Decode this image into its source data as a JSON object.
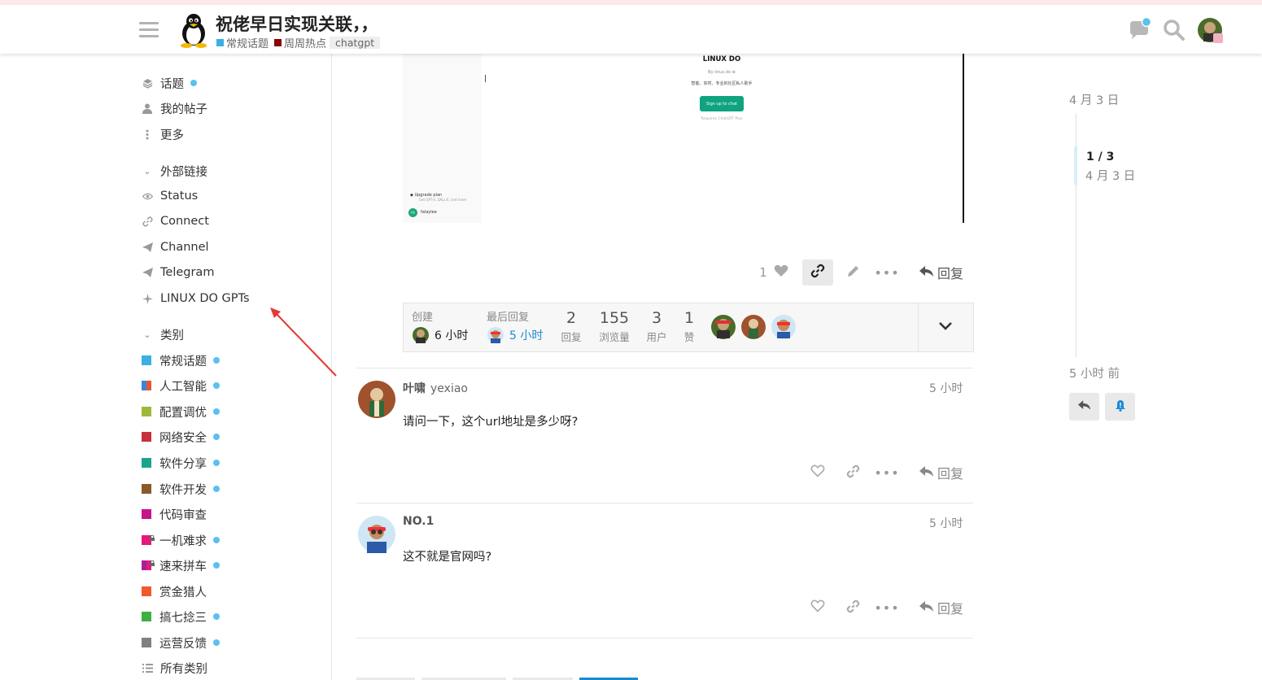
{
  "header": {
    "title": "祝佬早日实现关联，，",
    "category1": "常规话题",
    "category1_color": "#3ab0e2",
    "category2": "周周热点",
    "category2_color": "#8b0000",
    "tag": "chatgpt"
  },
  "embedded_image": {
    "heading": "LINUX DO",
    "by": "By linux.do",
    "desc": "智能、实时、专业的社区私人助手",
    "button": "Sign up to chat",
    "requires": "Requires ChatGPT Plus",
    "upgrade": "Upgrade plan",
    "upgrade_sub": "Get GPT-4, DALL·E, and more",
    "user_initials": "FA",
    "user": "falaylee"
  },
  "sidebar": {
    "top": [
      {
        "label": "话题",
        "icon": "layers-icon",
        "dot": true
      },
      {
        "label": "我的帖子",
        "icon": "user-icon",
        "dot": false
      },
      {
        "label": "更多",
        "icon": "more-vertical-icon",
        "dot": false
      }
    ],
    "links_heading": "外部链接",
    "links": [
      {
        "label": "Status",
        "icon": "eye-icon"
      },
      {
        "label": "Connect",
        "icon": "link-icon"
      },
      {
        "label": "Channel",
        "icon": "paper-plane-icon"
      },
      {
        "label": "Telegram",
        "icon": "paper-plane-icon"
      },
      {
        "label": "LINUX DO GPTs",
        "icon": "sparkle-icon"
      }
    ],
    "categories_heading": "类别",
    "categories": [
      {
        "label": "常规话题",
        "color": "#3ab0e2",
        "color2": "",
        "dot": true,
        "lock": false
      },
      {
        "label": "人工智能",
        "color": "#3a86d8",
        "color2": "#e45735",
        "dot": true,
        "lock": false
      },
      {
        "label": "配置调优",
        "color": "#9eb83b",
        "color2": "",
        "dot": true,
        "lock": false
      },
      {
        "label": "网络安全",
        "color": "#c62f3b",
        "color2": "",
        "dot": true,
        "lock": false
      },
      {
        "label": "软件分享",
        "color": "#1aa48c",
        "color2": "",
        "dot": true,
        "lock": false
      },
      {
        "label": "软件开发",
        "color": "#8a5a2b",
        "color2": "",
        "dot": true,
        "lock": false
      },
      {
        "label": "代码审查",
        "color": "#c7148a",
        "color2": "",
        "dot": false,
        "lock": false
      },
      {
        "label": "一机难求",
        "color": "#e6187c",
        "color2": "",
        "dot": true,
        "lock": true
      },
      {
        "label": "速来拼车",
        "color": "#a81e9c",
        "color2": "#e6187c",
        "dot": true,
        "lock": true
      },
      {
        "label": "赏金猎人",
        "color": "#f05a28",
        "color2": "",
        "dot": false,
        "lock": false
      },
      {
        "label": "搞七捻三",
        "color": "#3cb043",
        "color2": "",
        "dot": true,
        "lock": false
      },
      {
        "label": "运营反馈",
        "color": "#808080",
        "color2": "",
        "dot": true,
        "lock": false
      }
    ],
    "all_categories": "所有类别"
  },
  "first_post_actions": {
    "like_count": "1",
    "reply": "回复"
  },
  "topic_meta": {
    "created_label": "创建",
    "created_time": "6 小时",
    "last_reply_label": "最后回复",
    "last_reply_time": "5 小时",
    "stats": [
      {
        "num": "2",
        "label": "回复"
      },
      {
        "num": "155",
        "label": "浏览量"
      },
      {
        "num": "3",
        "label": "用户"
      },
      {
        "num": "1",
        "label": "赞"
      }
    ]
  },
  "posts": [
    {
      "name": "叶啸",
      "username": "yexiao",
      "time": "5 小时",
      "body": "请问一下，这个url地址是多少呀?",
      "reply": "回复"
    },
    {
      "name": "NO.1",
      "username": "",
      "time": "5 小时",
      "body": "这不就是官网吗?",
      "reply": "回复"
    }
  ],
  "timeline": {
    "start_date": "4 月 3 日",
    "position": "1 / 3",
    "position_date": "4 月 3 日",
    "end_text": "5 小时 前"
  }
}
